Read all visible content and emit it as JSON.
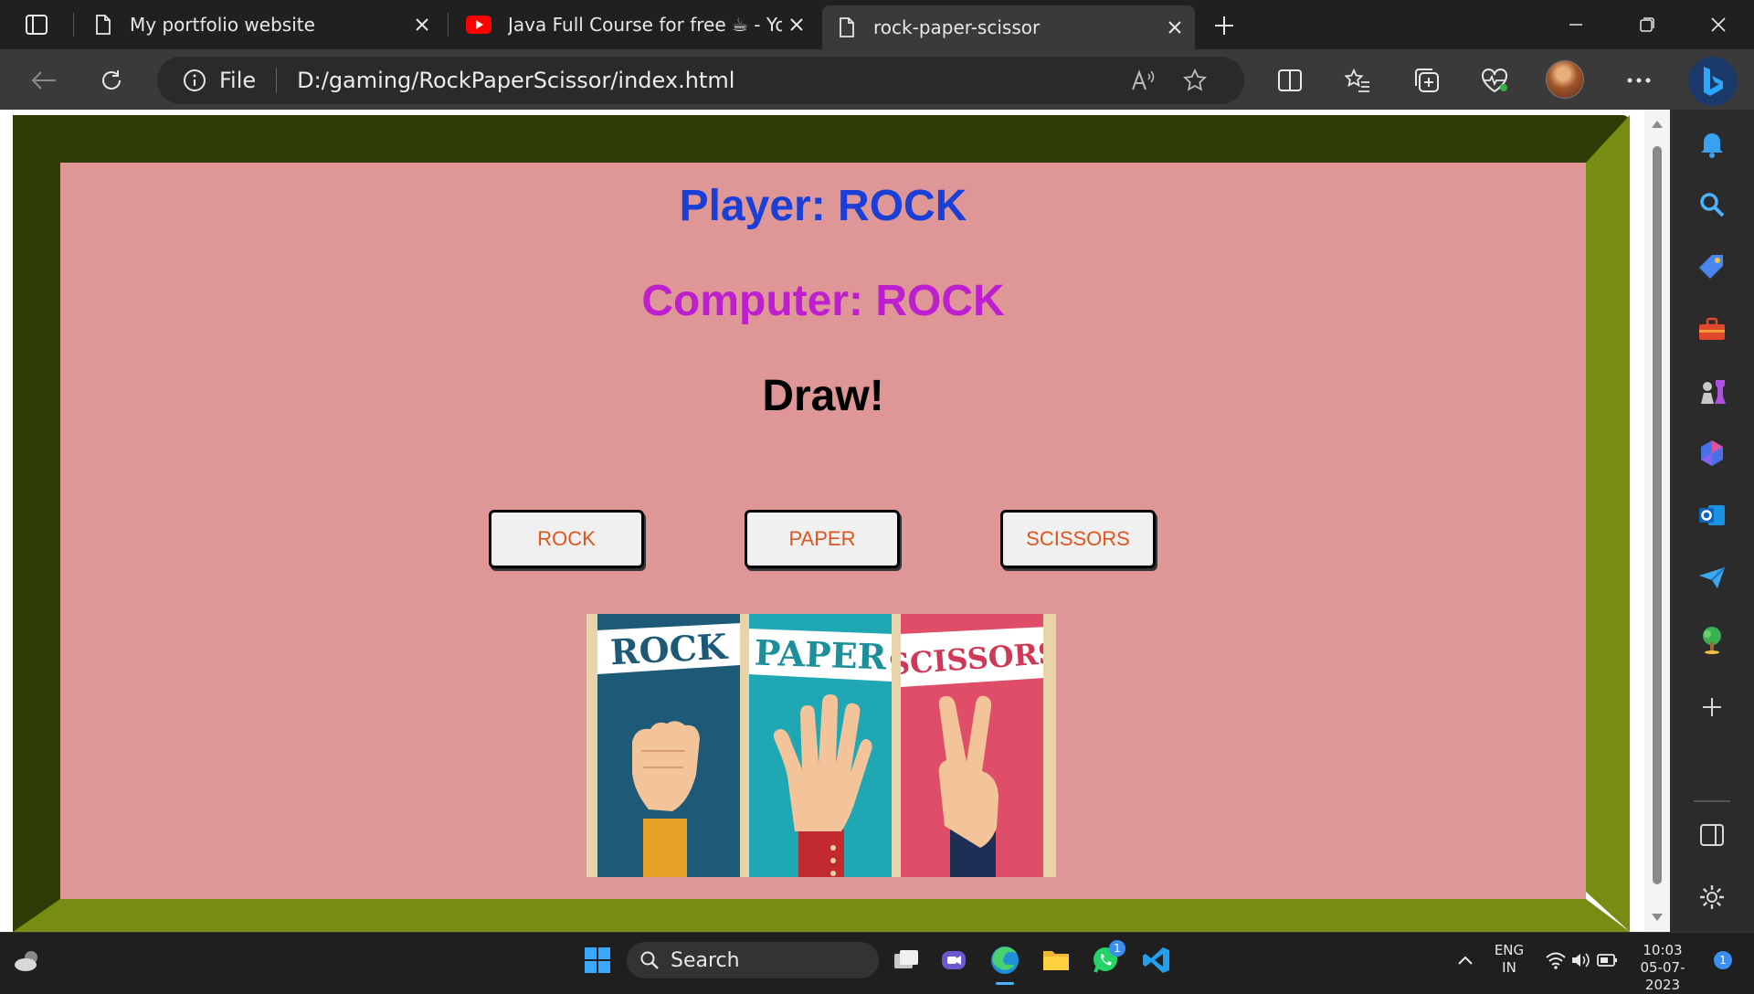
{
  "browser": {
    "tabs": [
      {
        "title": "My portfolio website",
        "favicon": "page-icon",
        "active": false
      },
      {
        "title": "Java Full Course for free ☕ - YouTube",
        "favicon": "youtube-icon",
        "active": false
      },
      {
        "title": "rock-paper-scissor",
        "favicon": "page-icon",
        "active": true
      }
    ],
    "address": {
      "scheme_label": "File",
      "url": "D:/gaming/RockPaperScissor/index.html"
    },
    "accent_colors": {
      "youtube": "#ff0000",
      "bing": "#2aa8ff"
    }
  },
  "game": {
    "player_text": "Player: ROCK",
    "computer_text": "Computer: ROCK",
    "result_text": "Draw!",
    "buttons": {
      "rock": "ROCK",
      "paper": "PAPER",
      "scissors": "SCISSORS"
    },
    "image_panels": [
      "ROCK",
      "PAPER",
      "SCISSORS"
    ],
    "colors": {
      "frame_dark": "#2e3c07",
      "frame_light": "#778c12",
      "stage": "#de9696",
      "player": "#1a3fd6",
      "computer": "#bd1fd0",
      "button_text": "#e0541c"
    }
  },
  "taskbar": {
    "search_label": "Search",
    "language": "ENG",
    "region": "IN",
    "time": "10:03",
    "date": "05-07-2023",
    "whatsapp_badge": "1",
    "notification_badge": "1"
  }
}
